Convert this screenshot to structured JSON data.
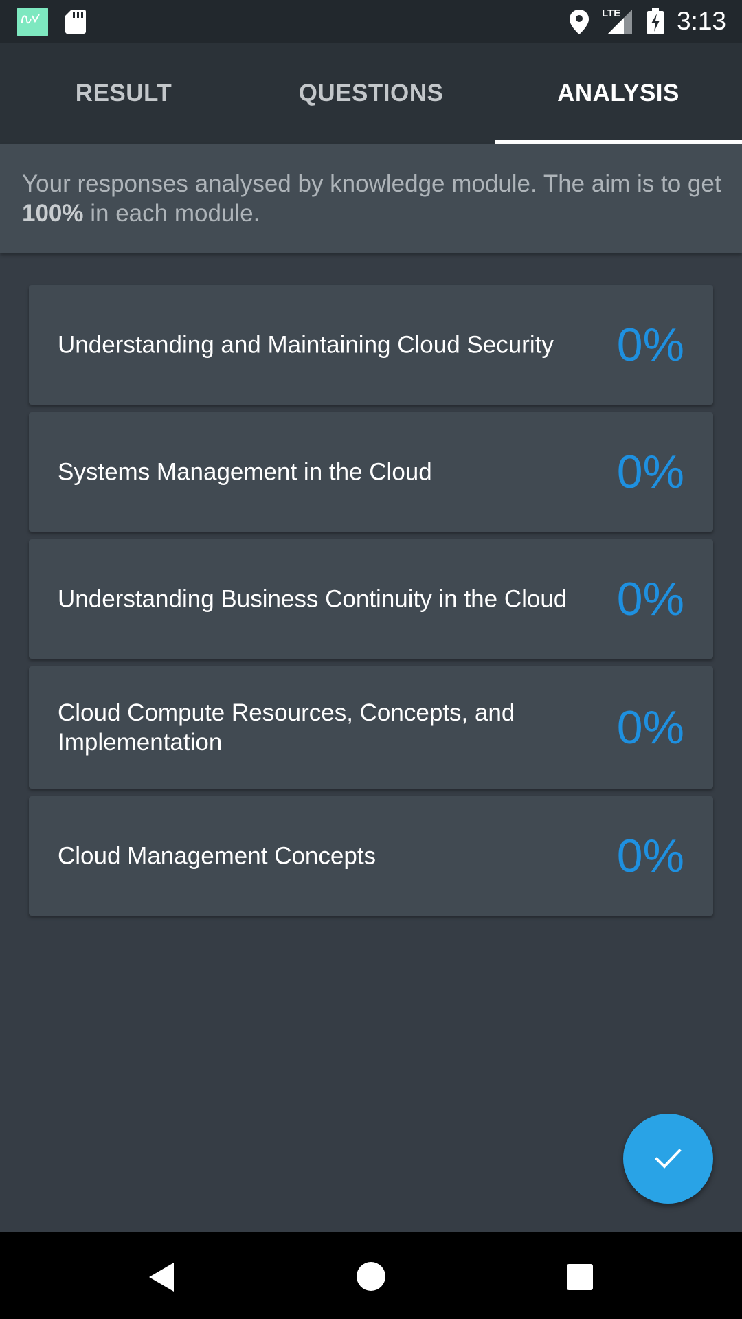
{
  "status_bar": {
    "time": "3:13",
    "network_label": "LTE",
    "icons": [
      "app-icon",
      "sd-card-icon",
      "location-icon",
      "signal-icon",
      "battery-charging-icon"
    ]
  },
  "tabs": [
    {
      "label": "RESULT",
      "active": false
    },
    {
      "label": "QUESTIONS",
      "active": false
    },
    {
      "label": "ANALYSIS",
      "active": true
    }
  ],
  "intro": {
    "text_before": "Your responses analysed by knowledge module. The aim is to get ",
    "emphasis": "100%",
    "text_after": " in each module."
  },
  "modules": [
    {
      "name": "Understanding and Maintaining Cloud Security",
      "score": "0%"
    },
    {
      "name": "Systems Management in the Cloud",
      "score": "0%"
    },
    {
      "name": "Understanding Business Continuity in the Cloud",
      "score": "0%"
    },
    {
      "name": "Cloud Compute Resources, Concepts, and Implementation",
      "score": "0%"
    },
    {
      "name": "Cloud Management Concepts",
      "score": "0%"
    }
  ],
  "fab": {
    "icon": "check-icon"
  },
  "nav_bar": {
    "icons": [
      "back-icon",
      "home-icon",
      "recents-icon"
    ]
  },
  "colors": {
    "background": "#363d45",
    "tab_bar": "#2b3238",
    "card": "#414a52",
    "score": "#1e90e0",
    "fab": "#29a3e6"
  }
}
